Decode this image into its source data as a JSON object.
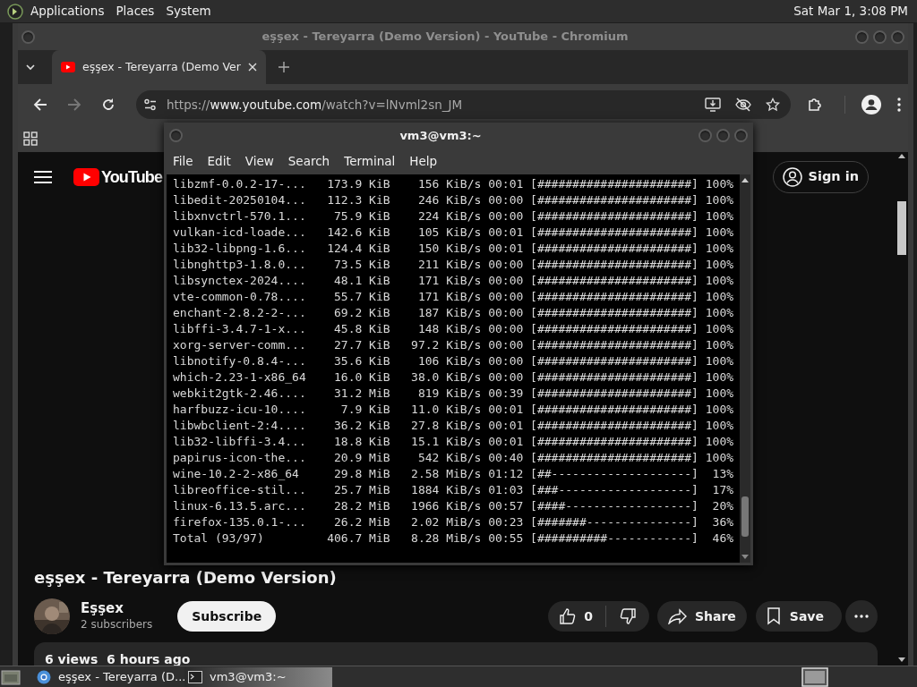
{
  "top_panel": {
    "menus": [
      "Applications",
      "Places",
      "System"
    ],
    "clock": "Sat Mar 1, 3:08 PM"
  },
  "browser": {
    "title": "eşşex - Tereyarra (Demo Version) - YouTube - Chromium",
    "tabs": [
      {
        "title": "eşşex - Tereyarra (Demo Ver",
        "selected": true
      }
    ],
    "url": "https://**www.youtube.com**/watch?v=lNvml2sn_JM",
    "page": {
      "logo": "YouTube",
      "sign_in": "Sign in",
      "video_title": "eşşex - Tereyarra (Demo Version)",
      "channel": "Eşşex",
      "subscribers": "2 subscribers",
      "subscribe": "Subscribe",
      "likes": "0",
      "share": "Share",
      "save": "Save",
      "description": "6 views  6 hours ago"
    }
  },
  "terminal": {
    "title": "vm3@vm3:~",
    "menu": [
      "File",
      "Edit",
      "View",
      "Search",
      "Terminal",
      "Help"
    ],
    "lines": [
      {
        "name": "libzmf-0.0.2-17-...",
        "size": "173.9 KiB",
        "speed": "156 KiB/s",
        "time": "00:01",
        "bar": "[######################]",
        "percent": "100%"
      },
      {
        "name": "libedit-20250104...",
        "size": "112.3 KiB",
        "speed": "246 KiB/s",
        "time": "00:00",
        "bar": "[######################]",
        "percent": "100%"
      },
      {
        "name": "libxnvctrl-570.1...",
        "size": "75.9 KiB",
        "speed": "224 KiB/s",
        "time": "00:00",
        "bar": "[######################]",
        "percent": "100%"
      },
      {
        "name": "vulkan-icd-loade...",
        "size": "142.6 KiB",
        "speed": "105 KiB/s",
        "time": "00:01",
        "bar": "[######################]",
        "percent": "100%"
      },
      {
        "name": "lib32-libpng-1.6...",
        "size": "124.4 KiB",
        "speed": "150 KiB/s",
        "time": "00:01",
        "bar": "[######################]",
        "percent": "100%"
      },
      {
        "name": "libnghttp3-1.8.0...",
        "size": "73.5 KiB",
        "speed": "211 KiB/s",
        "time": "00:00",
        "bar": "[######################]",
        "percent": "100%"
      },
      {
        "name": "libsynctex-2024....",
        "size": "48.1 KiB",
        "speed": "171 KiB/s",
        "time": "00:00",
        "bar": "[######################]",
        "percent": "100%"
      },
      {
        "name": "vte-common-0.78....",
        "size": "55.7 KiB",
        "speed": "171 KiB/s",
        "time": "00:00",
        "bar": "[######################]",
        "percent": "100%"
      },
      {
        "name": "enchant-2.8.2-2-...",
        "size": "69.2 KiB",
        "speed": "187 KiB/s",
        "time": "00:00",
        "bar": "[######################]",
        "percent": "100%"
      },
      {
        "name": "libffi-3.4.7-1-x...",
        "size": "45.8 KiB",
        "speed": "148 KiB/s",
        "time": "00:00",
        "bar": "[######################]",
        "percent": "100%"
      },
      {
        "name": "xorg-server-comm...",
        "size": "27.7 KiB",
        "speed": "97.2 KiB/s",
        "time": "00:00",
        "bar": "[######################]",
        "percent": "100%"
      },
      {
        "name": "libnotify-0.8.4-...",
        "size": "35.6 KiB",
        "speed": "106 KiB/s",
        "time": "00:00",
        "bar": "[######################]",
        "percent": "100%"
      },
      {
        "name": "which-2.23-1-x86_64",
        "size": "16.0 KiB",
        "speed": "38.0 KiB/s",
        "time": "00:00",
        "bar": "[######################]",
        "percent": "100%"
      },
      {
        "name": "webkit2gtk-2.46....",
        "size": "31.2 MiB",
        "speed": "819 KiB/s",
        "time": "00:39",
        "bar": "[######################]",
        "percent": "100%"
      },
      {
        "name": "harfbuzz-icu-10....",
        "size": "7.9 KiB",
        "speed": "11.0 KiB/s",
        "time": "00:01",
        "bar": "[######################]",
        "percent": "100%"
      },
      {
        "name": "libwbclient-2:4....",
        "size": "36.2 KiB",
        "speed": "27.8 KiB/s",
        "time": "00:01",
        "bar": "[######################]",
        "percent": "100%"
      },
      {
        "name": "lib32-libffi-3.4...",
        "size": "18.8 KiB",
        "speed": "15.1 KiB/s",
        "time": "00:01",
        "bar": "[######################]",
        "percent": "100%"
      },
      {
        "name": "papirus-icon-the...",
        "size": "20.9 MiB",
        "speed": "542 KiB/s",
        "time": "00:40",
        "bar": "[######################]",
        "percent": "100%"
      },
      {
        "name": "wine-10.2-2-x86_64",
        "size": "29.8 MiB",
        "speed": "2.58 MiB/s",
        "time": "01:12",
        "bar": "[##--------------------]",
        "percent": "13%"
      },
      {
        "name": "libreoffice-stil...",
        "size": "25.7 MiB",
        "speed": "1884 KiB/s",
        "time": "01:03",
        "bar": "[###-------------------]",
        "percent": "17%"
      },
      {
        "name": "linux-6.13.5.arc...",
        "size": "28.2 MiB",
        "speed": "1966 KiB/s",
        "time": "00:57",
        "bar": "[####------------------]",
        "percent": "20%"
      },
      {
        "name": "firefox-135.0.1-...",
        "size": "26.2 MiB",
        "speed": "2.02 MiB/s",
        "time": "00:23",
        "bar": "[#######---------------]",
        "percent": "36%"
      },
      {
        "name": "Total (93/97)",
        "size": "406.7 MiB",
        "speed": "8.28 MiB/s",
        "time": "00:55",
        "bar": "[##########------------]",
        "percent": "46%"
      }
    ]
  },
  "taskbar": {
    "tasks": [
      {
        "kind": "browser",
        "label": "eşşex - Tereyarra (D...",
        "selected": false
      },
      {
        "kind": "terminal",
        "label": "vm3@vm3:~",
        "selected": true
      }
    ]
  }
}
